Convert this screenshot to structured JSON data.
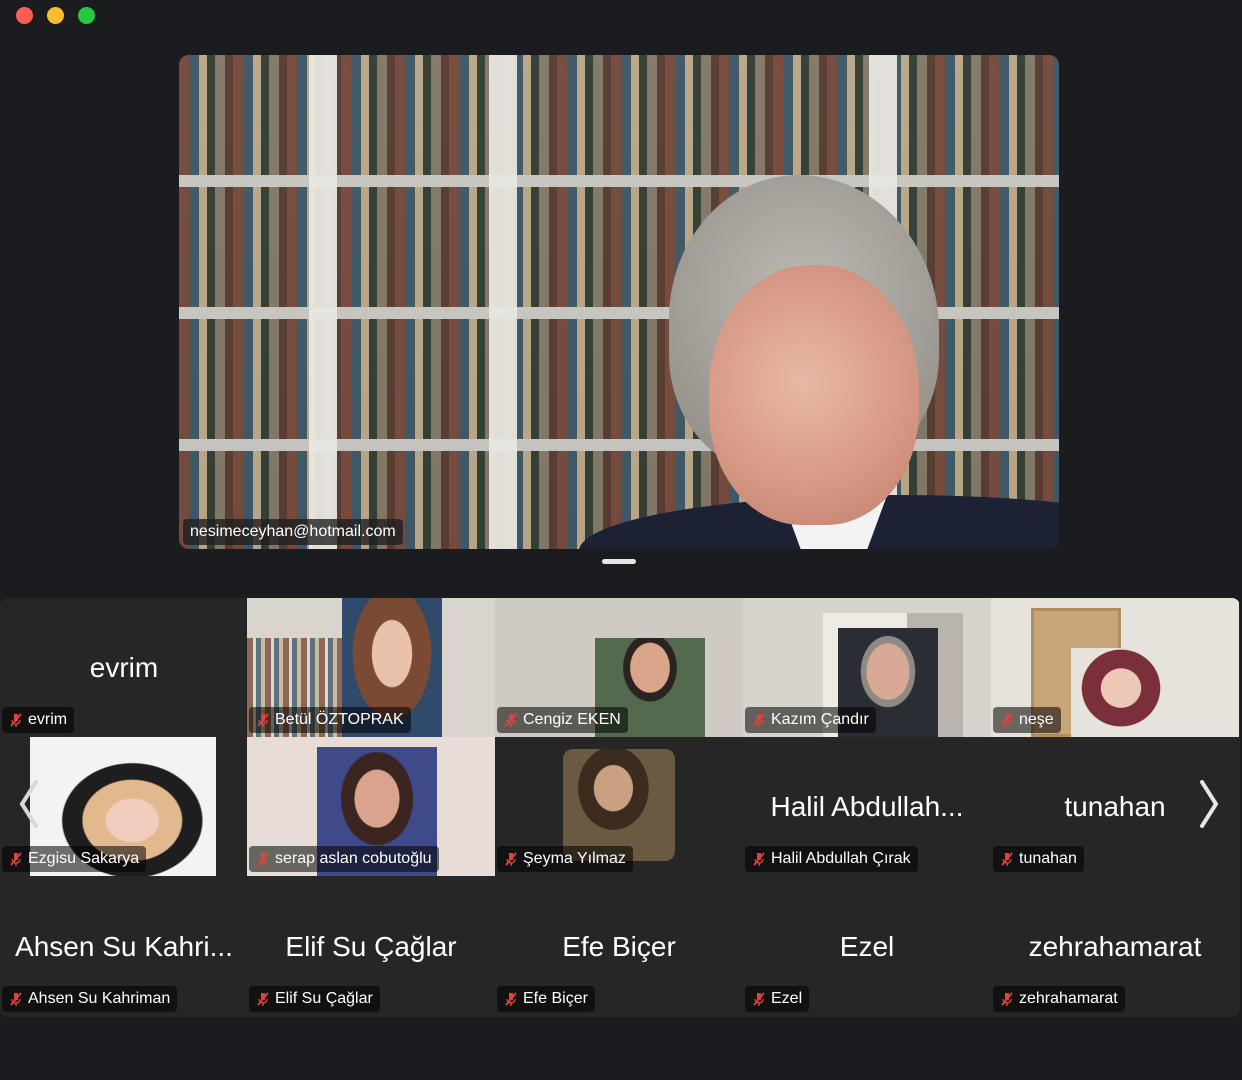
{
  "speaker": {
    "label": "nesimeceyhan@hotmail.com"
  },
  "gallery": {
    "tiles": [
      {
        "name": "evrim",
        "display": "evrim",
        "video": false
      },
      {
        "name": "Betül ÖZTOPRAK",
        "video": true
      },
      {
        "name": "Cengiz EKEN",
        "video": true
      },
      {
        "name": "Kazım Çandır",
        "video": true
      },
      {
        "name": "neşe",
        "video": true
      },
      {
        "name": "Ezgisu Sakarya",
        "video": true
      },
      {
        "name": "serap aslan cobutoğlu",
        "video": true
      },
      {
        "name": "Şeyma Yılmaz",
        "video": true
      },
      {
        "name": "Halil Abdullah Çırak",
        "display": "Halil Abdullah...",
        "video": false
      },
      {
        "name": "tunahan",
        "display": "tunahan",
        "video": false
      },
      {
        "name": "Ahsen Su Kahriman",
        "display": "Ahsen Su Kahri...",
        "video": false
      },
      {
        "name": "Elif Su Çağlar",
        "display": "Elif Su Çağlar",
        "video": false
      },
      {
        "name": "Efe Biçer",
        "display": "Efe Biçer",
        "video": false
      },
      {
        "name": "Ezel",
        "display": "Ezel",
        "video": false
      },
      {
        "name": "zehrahamarat",
        "display": "zehrahamarat",
        "video": false
      }
    ]
  },
  "nav": {
    "prev_icon": "chevron-left-icon",
    "next_icon": "chevron-right-icon"
  },
  "colors": {
    "mute": "#e0433a",
    "close": "#fd5e56",
    "minimize": "#fdbc2e",
    "zoom": "#27c840"
  }
}
